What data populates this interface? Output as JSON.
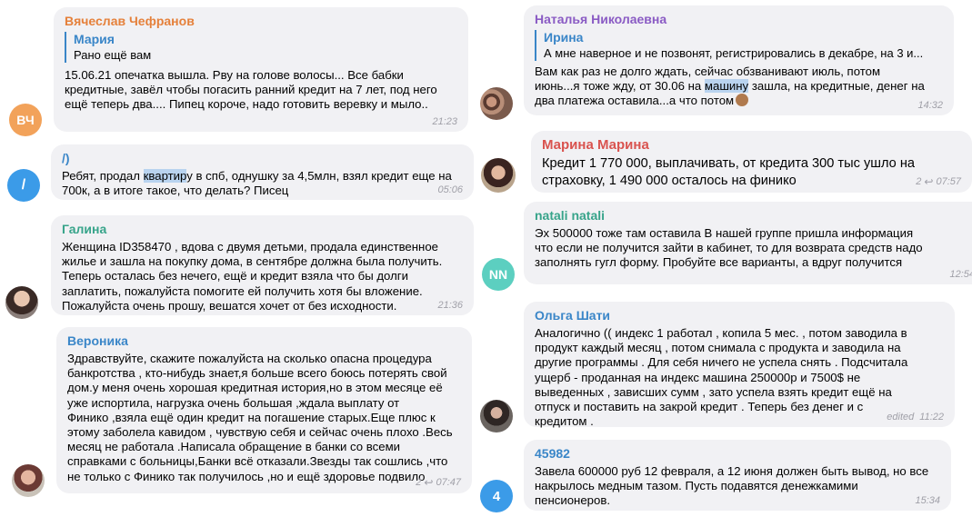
{
  "left": [
    {
      "id": "m1",
      "sender": "Вячеслав Чефранов",
      "sender_color": "#e5803a",
      "avatar": {
        "initials": "ВЧ",
        "color": "#f2a25a"
      },
      "quote": {
        "name": "Мария",
        "text": "Рано ещё вам"
      },
      "text": "15.06.21 опечатка вышла. Рву на голове волосы... Все бабки\nкредитные, завёл чтобы погасить ранний кредит на 7 лет, под него\nещё теперь два.... Пипец короче, надо готовить веревку и мыло..",
      "time": "21:23"
    },
    {
      "id": "m2",
      "sender": "/)",
      "sender_color": "#3a86c8",
      "avatar": {
        "initials": "/",
        "color": "#3b9be8"
      },
      "text_parts": [
        "Ребят, продал ",
        "квартир",
        "у в спб, однушку за 4,5млн, взял кредит еще на\n700к, а в итоге такое, что делать? Писец"
      ],
      "time": "05:06"
    },
    {
      "id": "m3",
      "sender": "Галина",
      "sender_color": "#37a48a",
      "text": "Женщина   ID358470 , вдова с двумя детьми, продала единственное\nжилье и зашла на покупку дома, в сентябре должна была получить.\nТеперь осталась без нечего, ещё и кредит взяла что бы долги\nзаплатить, пожалуйста помогите ей получить хотя бы вложение.\nПожалуйста очень прошу, вешатся хочет от без исходности.",
      "time": "21:36"
    },
    {
      "id": "m4",
      "sender": "Вероника",
      "sender_color": "#3a86c8",
      "text": "Здравствуйте, скажите пожалуйста на сколько опасна процедура\nбанкротства , кто-нибудь знает,я больше всего боюсь потерять свой\nдом.у меня очень хорошая кредитная история,но в этом месяце её\nуже испортила, нагрузка очень большая ,ждала выплату от\nФинико ,взяла ещё один кредит на погашение старых.Еще плюс к\nэтому заболела кавидом , чувствую себя и сейчас очень плохо .Весь\nмесяц не работала .Написала обращение в банки со всеми\nсправками с больницы,Банки всё отказали.Звезды так сошлись ,что\nне только с Финико так получилось ,но и ещё здоровье подвило",
      "replies": "2",
      "time": "07:47"
    }
  ],
  "right": [
    {
      "id": "m5",
      "sender": "Наталья Николаевна",
      "sender_color": "#8a5bc4",
      "quote": {
        "name": "Ирина",
        "text": "А мне наверное и не позвонят, регистрировались в декабре, на 3 и..."
      },
      "text_parts": [
        "Вам как раз не долго ждать, сейчас обзванивают июль, потом\nиюнь...я тоже жду, от 30.06 на ",
        "машину",
        " зашла, на кредитные, денег на\nдва платежа оставила...а что потом"
      ],
      "time": "14:32"
    },
    {
      "id": "m6",
      "sender": "Марина Марина",
      "sender_color": "#d9534f",
      "text": "Кредит 1 770 000, выплачивать, от кредита 300 тыс ушло на\nстраховку, 1 490 000 осталось на финико",
      "replies": "2",
      "time": "07:57"
    },
    {
      "id": "m7",
      "sender": "natali natali",
      "sender_color": "#37a48a",
      "avatar": {
        "initials": "NN",
        "color": "#5ccfc0"
      },
      "text": "Эх 500000 тоже там оставила  В нашей группе пришла информация\nчто если не получится зайти в кабинет, то для  возврата средств надо\nзаполнять гугл форму. Пробуйте все варианты, а вдруг получится",
      "time": "12:54"
    },
    {
      "id": "m8",
      "sender": "Ольга Шати",
      "sender_color": "#3a86c8",
      "text": "Аналогично (( индекс 1 работал , копила 5 мес. , потом заводила в\nпродукт каждый месяц , потом снимала с продукта и заводила  на\nдругие программы . Для себя ничего не успела снять . Подсчитала\nущерб - проданная на индекс машина 250000р  и 7500$ не\nвыведенных , зависших сумм , зато успела взять кредит ещё на\nотпуск и поставить на закрой кредит . Теперь без денег и с\nкредитом .",
      "edited": "edited",
      "time": "11:22"
    },
    {
      "id": "m9",
      "sender": "45982",
      "sender_color": "#3a86c8",
      "avatar": {
        "initials": "4",
        "color": "#3b9be8"
      },
      "text": "Завела 600000 руб 12 февраля, а 12 июня должен быть вывод, но все\nнакрылось медным тазом.  Пусть подавятся денежкамими\nпенсионеров.",
      "time": "15:34"
    }
  ]
}
